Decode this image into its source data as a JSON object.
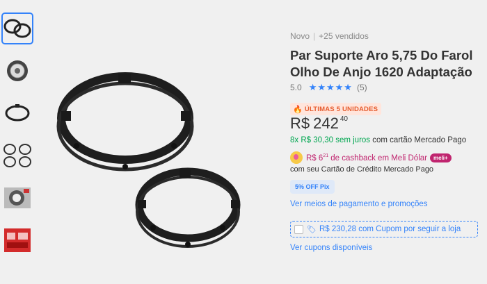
{
  "thumbnails": [
    {
      "icon": "two-rings-image",
      "selected": true
    },
    {
      "icon": "headlight-image",
      "selected": false
    },
    {
      "icon": "ring-side-image",
      "selected": false
    },
    {
      "icon": "ring-parts-image",
      "selected": false
    },
    {
      "icon": "installed-headlight-image",
      "selected": false
    },
    {
      "icon": "promo-image",
      "selected": false
    }
  ],
  "product": {
    "condition": "Novo",
    "separator": "|",
    "sold": "+25 vendidos",
    "title": "Par Suporte Aro 5,75 Do Farol Olho De Anjo 1620 Adaptação",
    "rating_value": "5.0",
    "stars": "★★★★★",
    "rating_count": "(5)",
    "badge": "ÚLTIMAS 5 UNIDADES",
    "price_currency": "R$",
    "price_integer": "242",
    "price_cents": "40",
    "installments_green": "8x R$ 30,30 sem juros",
    "installments_rest": " com cartão Mercado Pago",
    "cashback_pre": "R$ 6",
    "cashback_cents": "21",
    "cashback_post": " de cashback em Meli Dólar",
    "meli_badge": "meli+",
    "card_line": "com seu Cartão de Crédito Mercado Pago",
    "pix_badge": "5% OFF Pix",
    "payment_link": "Ver meios de pagamento e promoções",
    "coupon_text": "R$ 230,28 com Cupom por seguir a loja",
    "coupons_link": "Ver cupons disponíveis"
  },
  "colors": {
    "accent": "#3483fa",
    "green": "#00a650",
    "badge": "#e65c2e",
    "cashback": "#c0256f"
  }
}
